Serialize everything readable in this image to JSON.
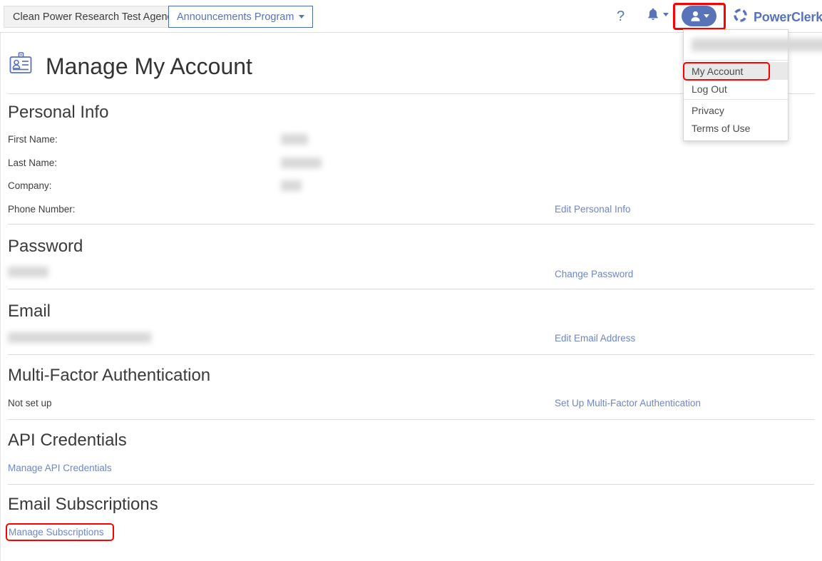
{
  "header": {
    "agency_name": "Clean Power Research Test Agency",
    "program_name": "Announcements Program",
    "help_label": "?",
    "brand_name": "PowerClerk",
    "brand_trademark": "®"
  },
  "user_menu": {
    "account_email_redacted": "█████████████████",
    "items": [
      {
        "label": "My Account",
        "highlighted": true
      },
      {
        "label": "Log Out",
        "highlighted": false
      },
      {
        "label": "Privacy",
        "highlighted": false
      },
      {
        "label": "Terms of Use",
        "highlighted": false
      }
    ]
  },
  "page": {
    "title": "Manage My Account",
    "icon": "id-badge-icon"
  },
  "personal_info": {
    "heading": "Personal Info",
    "fields": [
      {
        "label": "First Name:",
        "value": "████",
        "redacted": true
      },
      {
        "label": "Last Name:",
        "value": "██████",
        "redacted": true
      },
      {
        "label": "Company:",
        "value": "███",
        "redacted": true
      },
      {
        "label": "Phone Number:",
        "value": "",
        "redacted": false
      }
    ],
    "action_link": "Edit Personal Info"
  },
  "password": {
    "heading": "Password",
    "value": "██████",
    "action_link": "Change Password"
  },
  "email": {
    "heading": "Email",
    "value": "█████████████████████",
    "action_link": "Edit Email Address"
  },
  "mfa": {
    "heading": "Multi-Factor Authentication",
    "status": "Not set up",
    "action_link": "Set Up Multi-Factor Authentication"
  },
  "api_credentials": {
    "heading": "API Credentials",
    "action_link": "Manage API Credentials"
  },
  "email_subscriptions": {
    "heading": "Email Subscriptions",
    "action_link": "Manage Subscriptions"
  },
  "colors": {
    "brand_blue": "#5873b8",
    "link_blue": "#6f86c6",
    "highlight_red": "#ff0000",
    "divider_gray": "#dadada",
    "tab_gray": "#f2f2f2"
  }
}
